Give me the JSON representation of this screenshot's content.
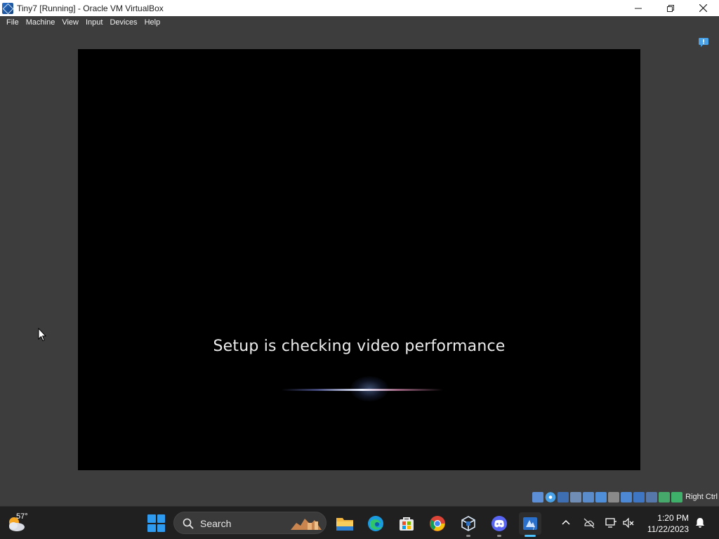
{
  "window": {
    "title": "Tiny7 [Running] - Oracle VM VirtualBox",
    "minimize_glyph": "—",
    "maximize_glyph": "▢",
    "close_glyph": "✕"
  },
  "menu": {
    "items": [
      "File",
      "Machine",
      "View",
      "Input",
      "Devices",
      "Help"
    ]
  },
  "vm": {
    "message": "Setup is checking video performance"
  },
  "statusbar": {
    "host_key": "Right Ctrl",
    "icons": [
      "hard-disk-icon",
      "optical-drive-icon",
      "floppy-icon",
      "audio-icon",
      "network-icon",
      "usb-icon",
      "shared-folders-icon",
      "display-icon",
      "recording-icon",
      "virtualization-icon",
      "guest-additions-icon",
      "keyboard-capture-icon"
    ]
  },
  "taskbar": {
    "weather_temp": "57°",
    "search_placeholder": "Search",
    "apps": [
      "file-explorer-icon",
      "edge-icon",
      "store-icon",
      "chrome-icon",
      "virtualbox-icon",
      "discord-icon",
      "vm-window-icon"
    ],
    "clock_time": "1:20 PM",
    "clock_date": "11/22/2023"
  },
  "colors": {
    "host_background": "#3d3d3d",
    "vm_background": "#000000",
    "taskbar": "#202020",
    "accent": "#4cc2ff",
    "start_blue": "#2f9bf0"
  }
}
